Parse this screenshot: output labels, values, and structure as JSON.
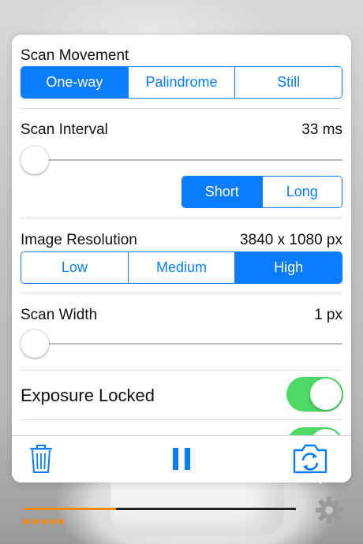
{
  "scan_movement": {
    "label": "Scan Movement",
    "options": [
      "One-way",
      "Palindrome",
      "Still"
    ],
    "selected": "One-way"
  },
  "scan_interval": {
    "label": "Scan Interval",
    "value": "33 ms",
    "slider_fraction": 0.0,
    "options": [
      "Short",
      "Long"
    ],
    "selected": "Short"
  },
  "image_resolution": {
    "label": "Image Resolution",
    "value": "3840 x 1080 px",
    "options": [
      "Low",
      "Medium",
      "High"
    ],
    "selected": "High"
  },
  "scan_width": {
    "label": "Scan Width",
    "value": "1 px",
    "slider_fraction": 0.0
  },
  "exposure_locked": {
    "label": "Exposure Locked",
    "on": true
  },
  "hidden_toggle": {
    "on": true
  },
  "toolbar": {
    "trash_icon": "trash-icon",
    "pause_icon": "pause-icon",
    "switch_camera_icon": "camera-switch-icon"
  },
  "bottom": {
    "progress": 0.34,
    "dot_count": 5,
    "settings_icon": "gear-icon"
  },
  "colors": {
    "accent": "#0a7cff",
    "toggle_on": "#4cd964",
    "progress": "#ff8a00"
  }
}
